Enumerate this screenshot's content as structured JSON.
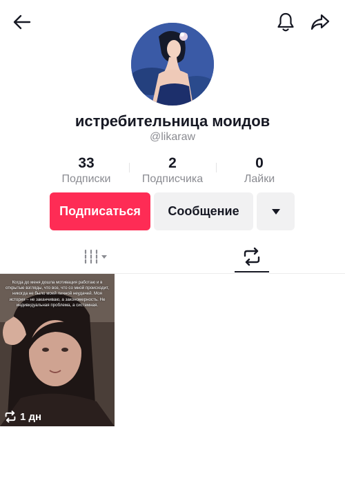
{
  "header": {
    "back": "arrow-left-icon",
    "notifications": "bell-icon",
    "share": "share-icon"
  },
  "profile": {
    "display_name": "истребительница моидов",
    "username": "@likaraw"
  },
  "stats": [
    {
      "value": "33",
      "label": "Подписки"
    },
    {
      "value": "2",
      "label": "Подписчика"
    },
    {
      "value": "0",
      "label": "Лайки"
    }
  ],
  "actions": {
    "follow_label": "Подписаться",
    "message_label": "Сообщение",
    "more": "caret-down-icon"
  },
  "tabs": [
    {
      "name": "videos",
      "icon": "grid-icon",
      "active": false
    },
    {
      "name": "reposts",
      "icon": "repost-icon",
      "active": true
    }
  ],
  "videos": [
    {
      "caption": "Когда до меня дошла мотивация работаю и в открытые взгляды, что все, что со мной происходит, никогда не было моей личной неудачей. Моя история – не заканчиваю, а закономерность. Не индивидуальная проблема, а системная.",
      "repost_time": "1 дн"
    }
  ],
  "colors": {
    "accent": "#fe2c55",
    "secondary_button": "#f1f1f2",
    "muted_text": "#8a8b91"
  }
}
